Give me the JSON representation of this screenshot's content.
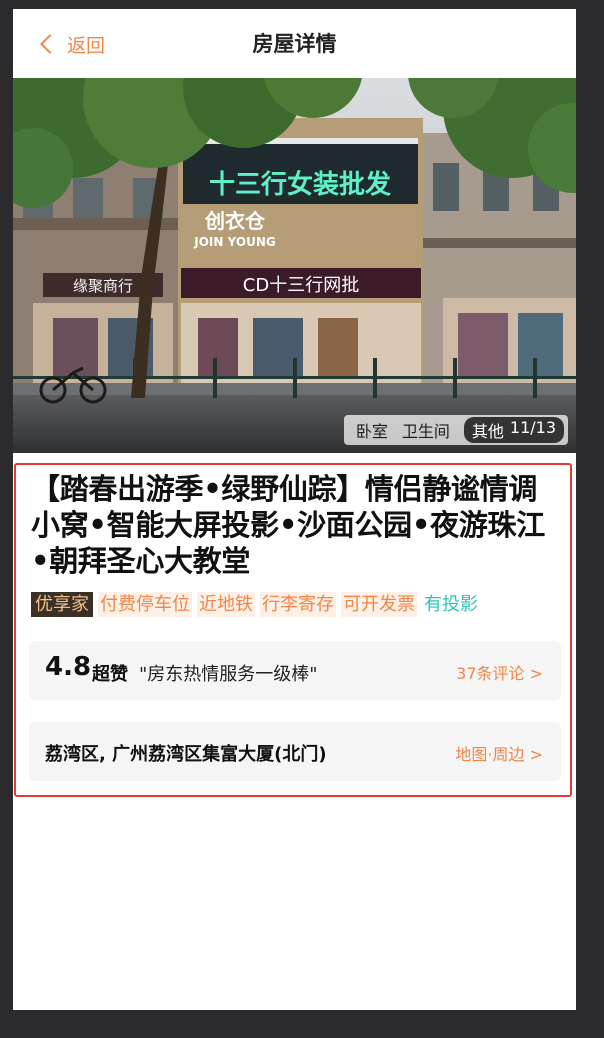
{
  "nav": {
    "back_label": "返回",
    "title": "房屋详情"
  },
  "gallery": {
    "storefront_sign_main": "十三行女装批发",
    "storefront_sign_brand": "创衣仓",
    "storefront_sign_brand_en": "JOIN YOUNG",
    "storefront_sign_lower": "CD十三行网批",
    "storefront_sign_left": "缘聚商行",
    "tabs": [
      "卧室",
      "卫生间"
    ],
    "active_tab": "其他",
    "counter": "11/13"
  },
  "listing": {
    "title": "【踏春出游季•绿野仙踪】情侣静谧情调小窝•智能大屏投影•沙面公园•夜游珠江•朝拜圣心大教堂",
    "tags": [
      {
        "label": "优享家",
        "style": "premium"
      },
      {
        "label": "付费停车位",
        "style": "orange"
      },
      {
        "label": "近地铁",
        "style": "orange"
      },
      {
        "label": "行李寄存",
        "style": "orange"
      },
      {
        "label": "可开发票",
        "style": "orange"
      },
      {
        "label": "有投影",
        "style": "teal"
      }
    ]
  },
  "review": {
    "score": "4.8",
    "level": "超赞",
    "quote": "\"房东热情服务一级棒\"",
    "link": "37条评论 >"
  },
  "address": {
    "text": "荔湾区, 广州荔湾区集富大厦(北门)",
    "link": "地图·周边 >"
  },
  "colors": {
    "accent": "#f0864a",
    "highlight_border": "#e53935",
    "teal_tag": "#2ec4b6",
    "background": "#2b2b2d"
  },
  "icons": {
    "back": "chevron-left-icon"
  }
}
